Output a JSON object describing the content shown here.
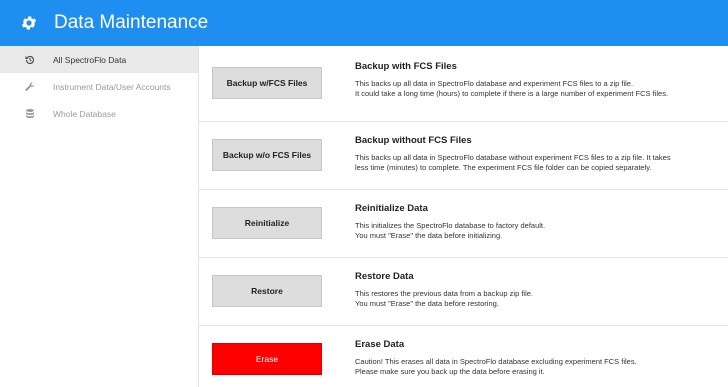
{
  "header": {
    "title": "Data Maintenance",
    "icon": "gear-icon",
    "bg": "#1e8ff0"
  },
  "sidebar": {
    "items": [
      {
        "label": "All SpectroFlo Data",
        "icon": "restore-clock-icon",
        "active": true
      },
      {
        "label": "Instrument Data/User Accounts",
        "icon": "wrench-icon",
        "active": false
      },
      {
        "label": "Whole Database",
        "icon": "database-icon",
        "active": false
      }
    ]
  },
  "actions": [
    {
      "button": "Backup w/FCS Files",
      "title": "Backup with FCS Files",
      "desc1": "This backs up all data in SpectroFlo database and experiment FCS files to a zip file.",
      "desc2": "It could take a long time (hours) to complete if there is a large number of experiment FCS files."
    },
    {
      "button": "Backup w/o FCS Files",
      "title": "Backup without FCS Files",
      "desc1": "This backs up all data in SpectroFlo database without experiment FCS files to a zip file. It takes",
      "desc2": "less time (minutes) to complete. The experiment FCS file folder can be copied separately."
    },
    {
      "button": "Reinitialize",
      "title": "Reinitialize Data",
      "desc1": "This initializes the SpectroFlo database to factory default.",
      "desc2": "You must \"Erase\" the data before initializing."
    },
    {
      "button": "Restore",
      "title": "Restore Data",
      "desc1": "This restores the previous data from a backup zip file.",
      "desc2": "You must \"Erase\" the data before restoring."
    },
    {
      "button": "Erase",
      "title": "Erase Data",
      "desc1": "Caution! This erases all data in SpectroFlo database excluding experiment FCS files.",
      "desc2": "Please make sure you back up the data before erasing it.",
      "button_color": "#ff0000"
    }
  ]
}
